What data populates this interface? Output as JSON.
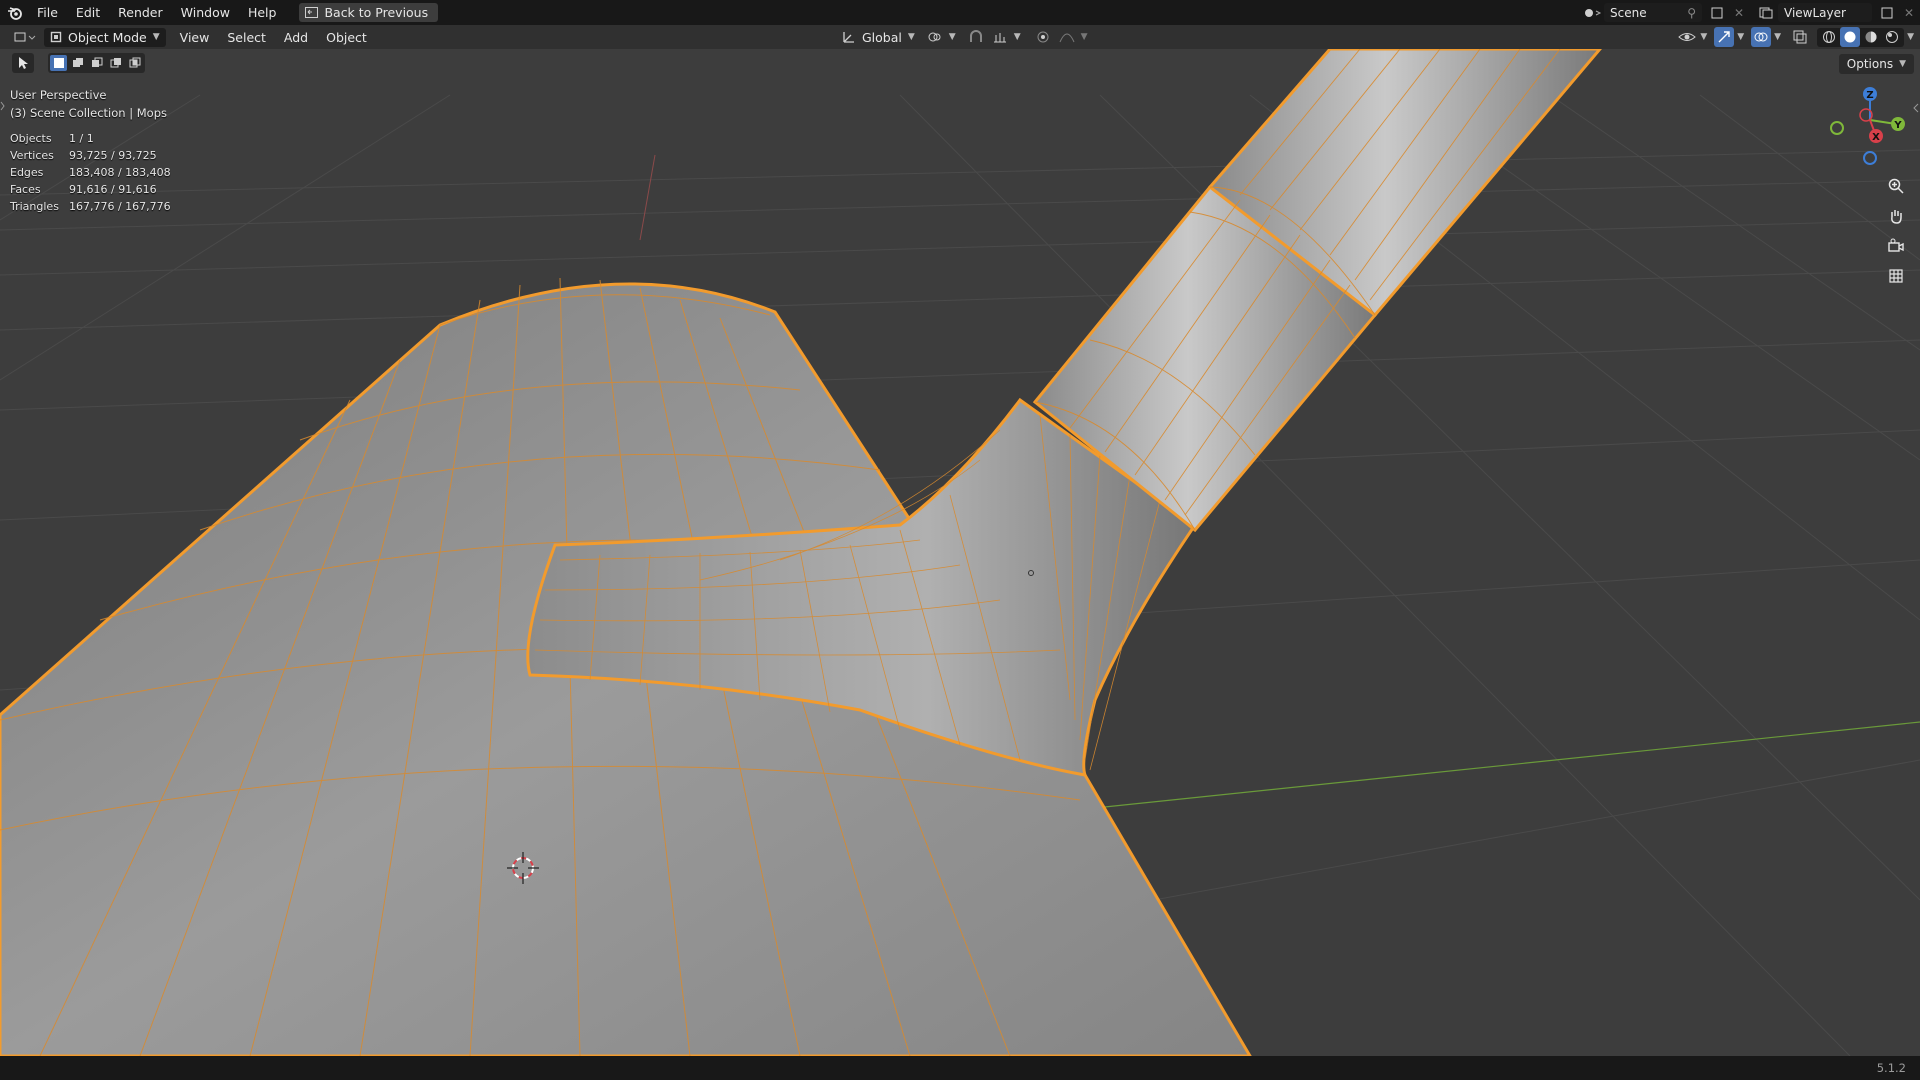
{
  "menu": {
    "items": [
      "File",
      "Edit",
      "Render",
      "Window",
      "Help"
    ],
    "back_label": "Back to Previous"
  },
  "topbar_right": {
    "scene": "Scene",
    "view_layer": "ViewLayer"
  },
  "viewport_header": {
    "mode": "Object Mode",
    "menus": [
      "View",
      "Select",
      "Add",
      "Object"
    ],
    "transform_orientation": "Global"
  },
  "options_label": "Options",
  "overlay": {
    "view_name": "User Perspective",
    "collection": "(3) Scene Collection | Mops"
  },
  "stats": [
    {
      "label": "Objects",
      "value": "1 / 1"
    },
    {
      "label": "Vertices",
      "value": "93,725 / 93,725"
    },
    {
      "label": "Edges",
      "value": "183,408 / 183,408"
    },
    {
      "label": "Faces",
      "value": "91,616 / 91,616"
    },
    {
      "label": "Triangles",
      "value": "167,776 / 167,776"
    }
  ],
  "gizmo": {
    "x": "X",
    "y": "Y",
    "z": "Z"
  },
  "version": "5.1.2",
  "colors": {
    "selection_outline": "#f29b2d",
    "x_axis": "#d8404a",
    "y_axis": "#7fb83a",
    "z_axis": "#3d7ed8",
    "active_blue": "#4772b3"
  },
  "icons": [
    "blender-logo-icon",
    "editor-type-icon",
    "mode-icon",
    "orientation-icon",
    "pivot-icon",
    "snap-icon",
    "proportional-icon",
    "visibility-icon",
    "gizmo-icon",
    "overlay-icon",
    "xray-icon",
    "wireframe-shading-icon",
    "solid-shading-icon",
    "material-shading-icon",
    "rendered-shading-icon",
    "zoom-icon",
    "pan-icon",
    "camera-icon",
    "grid-icon",
    "cursor-3d-icon"
  ]
}
